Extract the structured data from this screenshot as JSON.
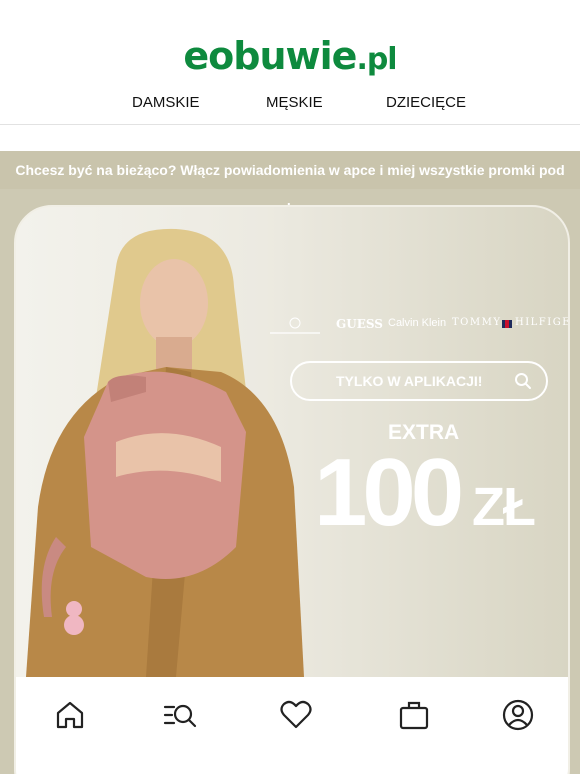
{
  "header": {
    "logo_main": "eobuwie",
    "logo_tld": ".pl",
    "nav": [
      {
        "label": "DAMSKIE"
      },
      {
        "label": "MĘSKIE"
      },
      {
        "label": "DZIECIĘCE"
      }
    ]
  },
  "banner": {
    "notice": "Chcesz być na bieżąco? Włącz powiadomienia w apce i miej wszystkie promki pod ręką.",
    "brands": [
      "GUESS",
      "Calvin Klein",
      "TOMMY",
      "HILFIGER"
    ],
    "cta_label": "TYLKO W APLIKACJI!",
    "extra_label": "EXTRA",
    "amount": "100",
    "currency": "ZŁ",
    "tab_icons": [
      "home-icon",
      "search-list-icon",
      "heart-icon",
      "bag-icon",
      "profile-icon"
    ],
    "colors": {
      "brand_green": "#0e8a3e",
      "banner_bg": "#cdc9b3",
      "text_white": "#ffffff"
    }
  }
}
